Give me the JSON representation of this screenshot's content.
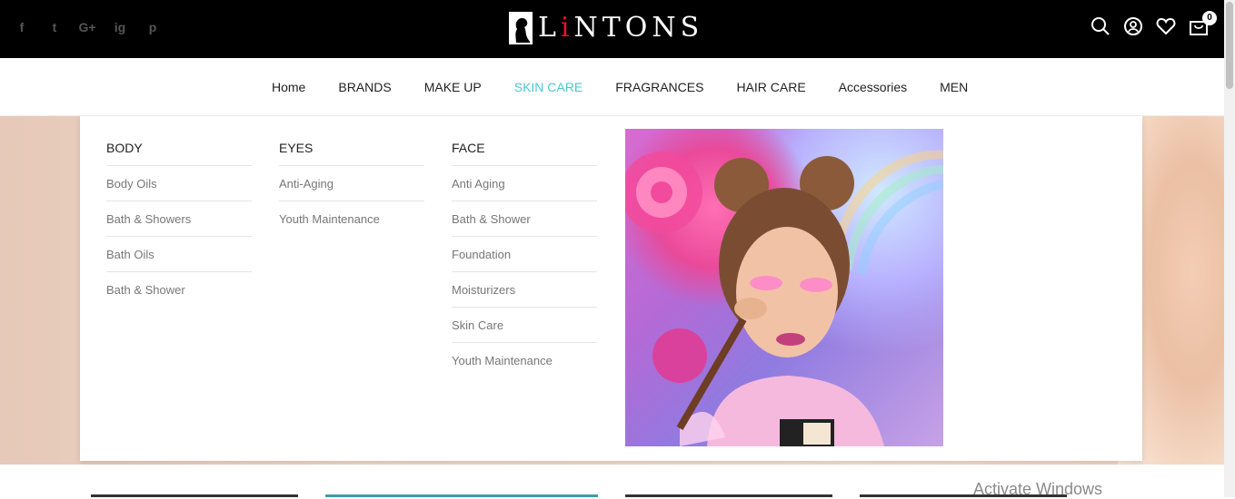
{
  "header": {
    "social": [
      "f",
      "t",
      "G+",
      "ig",
      "p"
    ],
    "logo_text_pre": "L",
    "logo_text_i": "i",
    "logo_text_post": "NTONS",
    "cart_count": "0",
    "icons": [
      "search-icon",
      "user-icon",
      "heart-icon",
      "cart-icon"
    ]
  },
  "nav": {
    "items": [
      {
        "label": "Home",
        "active": false
      },
      {
        "label": "BRANDS",
        "active": false
      },
      {
        "label": "MAKE UP",
        "active": false
      },
      {
        "label": "SKIN CARE",
        "active": true
      },
      {
        "label": "FRAGRANCES",
        "active": false
      },
      {
        "label": "HAIR CARE",
        "active": false
      },
      {
        "label": "Accessories",
        "active": false
      },
      {
        "label": "MEN",
        "active": false
      }
    ],
    "active_color": "#49c8d6"
  },
  "mega_menu": {
    "columns": [
      {
        "title": "BODY",
        "links": [
          "Body Oils",
          "Bath & Showers",
          "Bath Oils",
          "Bath & Shower"
        ]
      },
      {
        "title": "EYES",
        "links": [
          "Anti-Aging",
          "Youth Maintenance"
        ]
      },
      {
        "title": "FACE",
        "links": [
          "Anti Aging",
          "Bath & Shower",
          "Foundation",
          "Moisturizers",
          "Skin Care",
          "Youth Maintenance"
        ]
      }
    ]
  },
  "watermark": "Activate Windows"
}
